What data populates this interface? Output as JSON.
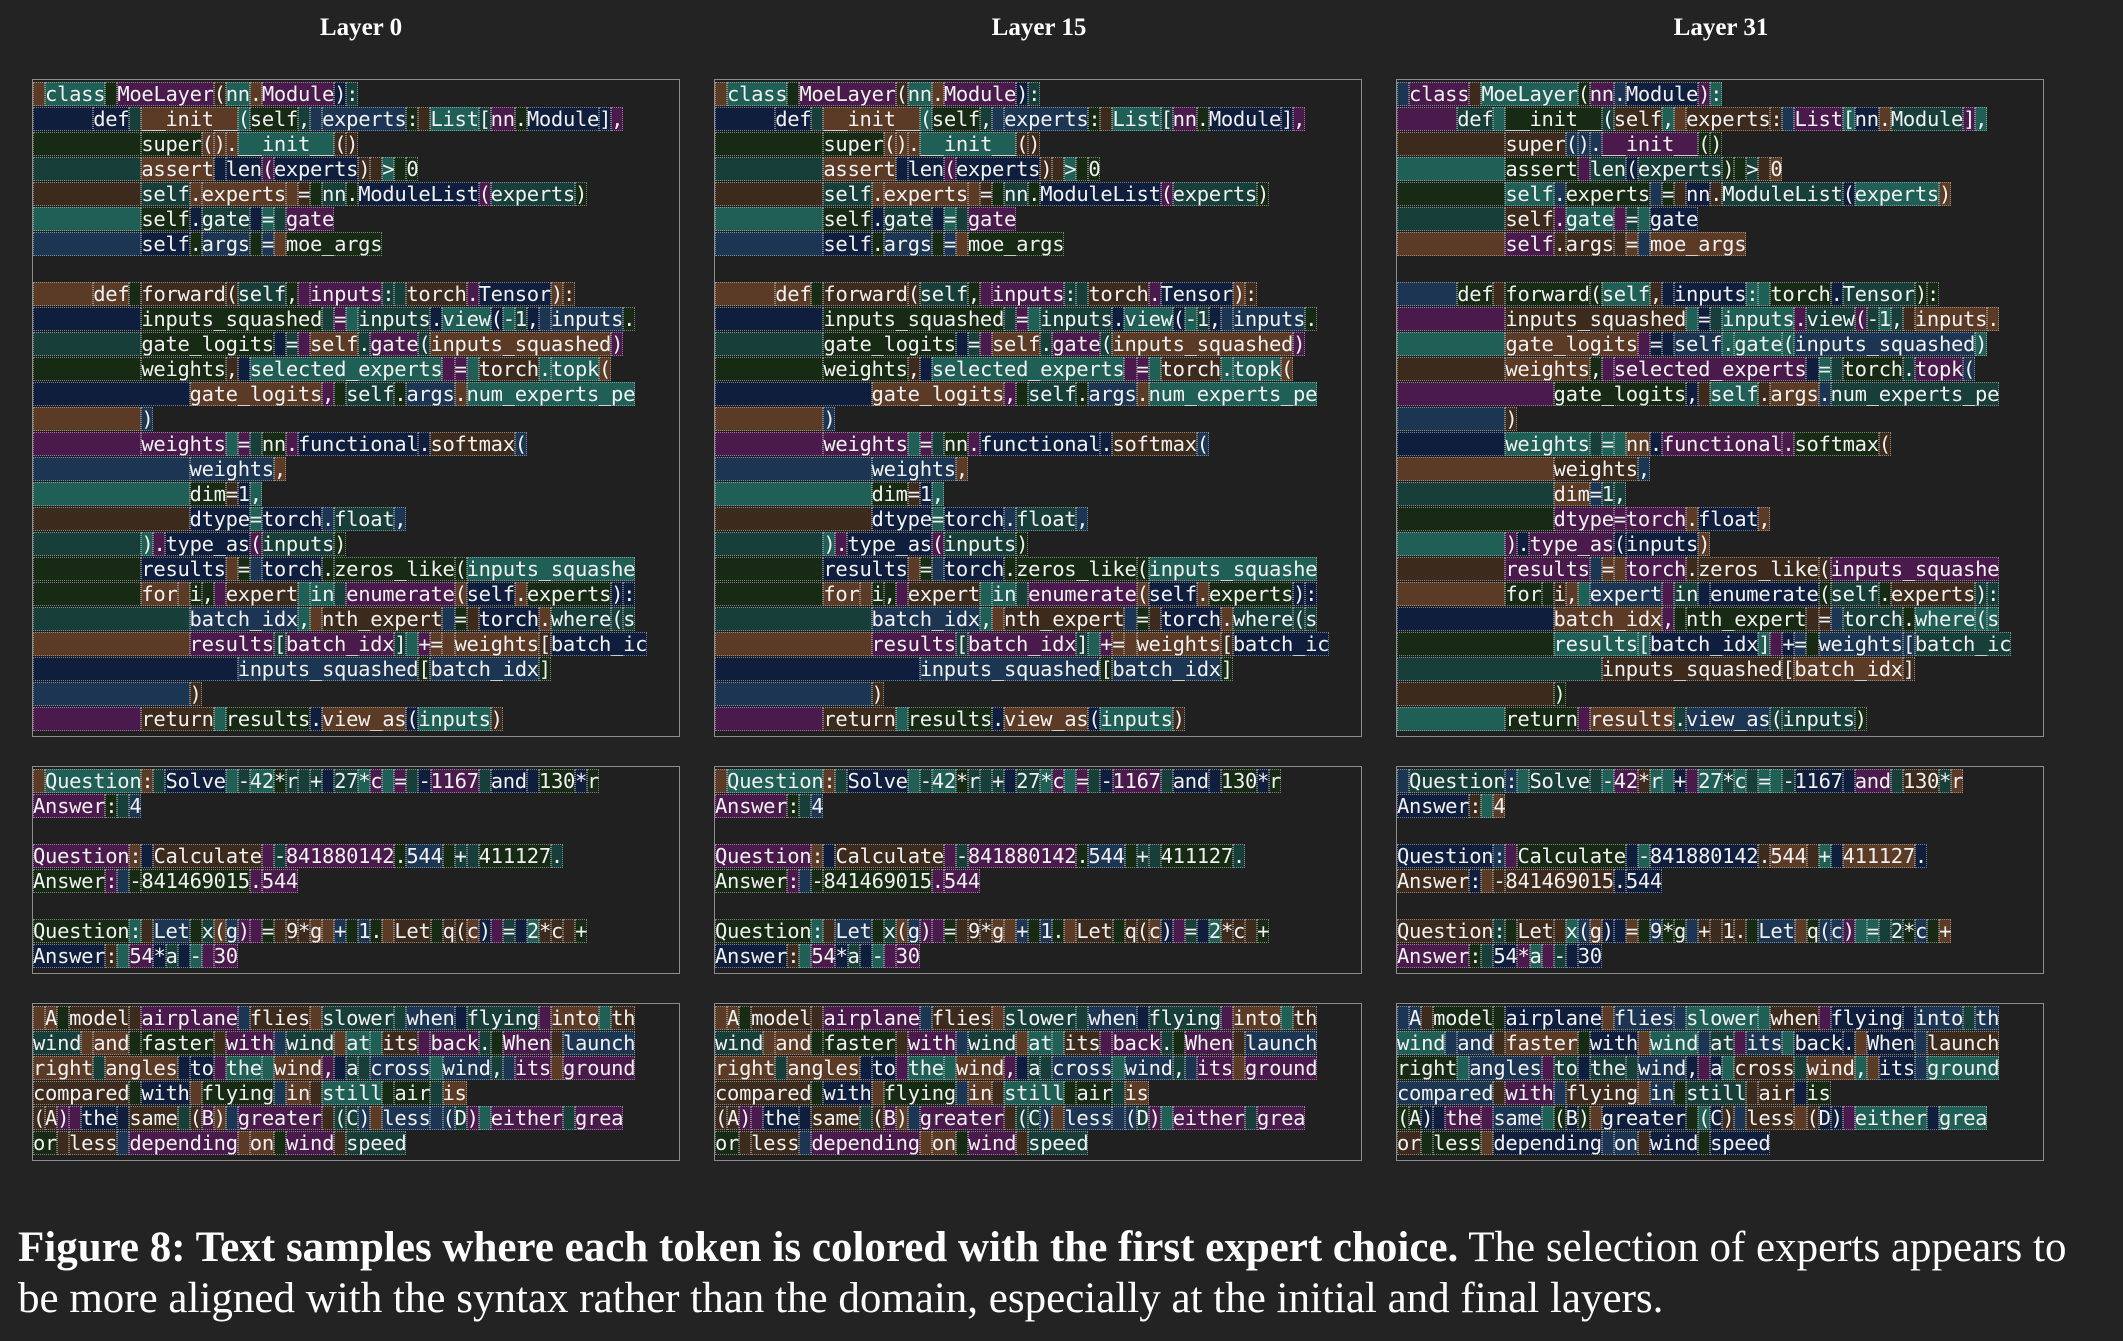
{
  "columns": [
    {
      "title": "Layer 0",
      "seed": 3
    },
    {
      "title": "Layer 15",
      "seed": 11
    },
    {
      "title": "Layer 31",
      "seed": 29
    }
  ],
  "panels": [
    {
      "name": "code-sample",
      "lines": [
        " class MoeLayer(nn.Module):",
        "     def __init__(self, experts: List[nn.Module],",
        "         super().__init__()",
        "         assert len(experts) > 0",
        "         self.experts = nn.ModuleList(experts)",
        "         self.gate = gate",
        "         self.args = moe_args",
        "",
        "     def forward(self, inputs: torch.Tensor):",
        "         inputs_squashed = inputs.view(-1, inputs.",
        "         gate_logits = self.gate(inputs_squashed)",
        "         weights, selected_experts = torch.topk(",
        "             gate_logits, self.args.num_experts_pe",
        "         )",
        "         weights = nn.functional.softmax(",
        "             weights,",
        "             dim=1,",
        "             dtype=torch.float,",
        "         ).type_as(inputs)",
        "         results = torch.zeros_like(inputs_squashe",
        "         for i, expert in enumerate(self.experts):",
        "             batch_idx, nth_expert = torch.where(s",
        "             results[batch_idx] += weights[batch_ic",
        "                 inputs_squashed[batch_idx]",
        "             )",
        "         return results.view_as(inputs)"
      ]
    },
    {
      "name": "math-sample",
      "lines": [
        " Question: Solve -42*r + 27*c = -1167 and 130*r",
        "Answer: 4",
        "",
        "Question: Calculate -841880142.544 + 411127.",
        "Answer: -841469015.544",
        "",
        "Question: Let x(g) = 9*g + 1. Let q(c) = 2*c +",
        "Answer: 54*a - 30"
      ]
    },
    {
      "name": "text-sample",
      "lines": [
        " A model airplane flies slower when flying into th",
        "wind and faster with wind at its back. When launch",
        "right angles to the wind, a cross wind, its ground",
        "compared with flying in still air is",
        "(A) the same (B) greater (C) less (D) either grea",
        "or less depending on wind speed"
      ]
    }
  ],
  "expert_colors": [
    "#1b3552",
    "#1f5f55",
    "#5b3a26",
    "#4a1a4c",
    "#162a14",
    "#101e3e",
    "#3c2a1c",
    "#173e38"
  ],
  "caption": {
    "label": "Figure 8: Text samples where each token is colored with the first expert choice.",
    "text": " The selection of experts appears to be more aligned with the syntax rather than the domain, especially at the initial and final layers."
  }
}
